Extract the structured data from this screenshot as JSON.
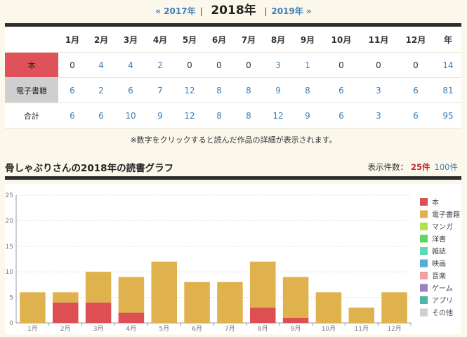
{
  "nav": {
    "prev": "« 2017年",
    "current": "2018年",
    "next": "2019年 »",
    "sep1": "|",
    "sep2": "|"
  },
  "table": {
    "headers": [
      "1月",
      "2月",
      "3月",
      "4月",
      "5月",
      "6月",
      "7月",
      "8月",
      "9月",
      "10月",
      "11月",
      "12月",
      "年"
    ],
    "rows": [
      {
        "label": "本",
        "values": [
          "0",
          "4",
          "4",
          "2",
          "0",
          "0",
          "0",
          "3",
          "1",
          "0",
          "0",
          "0",
          "14"
        ]
      },
      {
        "label": "電子書籍",
        "values": [
          "6",
          "2",
          "6",
          "7",
          "12",
          "8",
          "8",
          "9",
          "8",
          "6",
          "3",
          "6",
          "81"
        ]
      },
      {
        "label": "合計",
        "values": [
          "6",
          "6",
          "10",
          "9",
          "12",
          "8",
          "8",
          "12",
          "9",
          "6",
          "3",
          "6",
          "95"
        ]
      }
    ]
  },
  "note": "※数字をクリックすると読んだ作品の詳細が表示されます。",
  "graph": {
    "title": "骨しゃぶりさんの2018年の読書グラフ",
    "count_label": "表示件数：",
    "count_active": "25件",
    "count_other": "100件"
  },
  "chart_data": {
    "type": "bar",
    "stacked": true,
    "categories": [
      "1月",
      "2月",
      "3月",
      "4月",
      "5月",
      "6月",
      "7月",
      "8月",
      "9月",
      "10月",
      "11月",
      "12月"
    ],
    "series": [
      {
        "name": "本",
        "color": "#de4f54",
        "values": [
          0,
          4,
          4,
          2,
          0,
          0,
          0,
          3,
          1,
          0,
          0,
          0
        ]
      },
      {
        "name": "電子書籍",
        "color": "#e0b24e",
        "values": [
          6,
          2,
          6,
          7,
          12,
          8,
          8,
          9,
          8,
          6,
          3,
          6
        ]
      },
      {
        "name": "マンガ",
        "color": "#b6e04a",
        "values": [
          0,
          0,
          0,
          0,
          0,
          0,
          0,
          0,
          0,
          0,
          0,
          0
        ]
      },
      {
        "name": "洋書",
        "color": "#5fd45f",
        "values": [
          0,
          0,
          0,
          0,
          0,
          0,
          0,
          0,
          0,
          0,
          0,
          0
        ]
      },
      {
        "name": "雑誌",
        "color": "#5ed9b0",
        "values": [
          0,
          0,
          0,
          0,
          0,
          0,
          0,
          0,
          0,
          0,
          0,
          0
        ]
      },
      {
        "name": "映画",
        "color": "#5aa9dc",
        "values": [
          0,
          0,
          0,
          0,
          0,
          0,
          0,
          0,
          0,
          0,
          0,
          0
        ]
      },
      {
        "name": "音楽",
        "color": "#f0a0a0",
        "values": [
          0,
          0,
          0,
          0,
          0,
          0,
          0,
          0,
          0,
          0,
          0,
          0
        ]
      },
      {
        "name": "ゲーム",
        "color": "#a07fc0",
        "values": [
          0,
          0,
          0,
          0,
          0,
          0,
          0,
          0,
          0,
          0,
          0,
          0
        ]
      },
      {
        "name": "アプリ",
        "color": "#4fb3a8",
        "values": [
          0,
          0,
          0,
          0,
          0,
          0,
          0,
          0,
          0,
          0,
          0,
          0
        ]
      },
      {
        "name": "その他",
        "color": "#cfcfcf",
        "values": [
          0,
          0,
          0,
          0,
          0,
          0,
          0,
          0,
          0,
          0,
          0,
          0
        ]
      }
    ],
    "yticks": [
      "0",
      "5",
      "10",
      "15",
      "20",
      "25"
    ],
    "ylim": [
      0,
      25
    ],
    "grid": true,
    "legend": "right"
  }
}
